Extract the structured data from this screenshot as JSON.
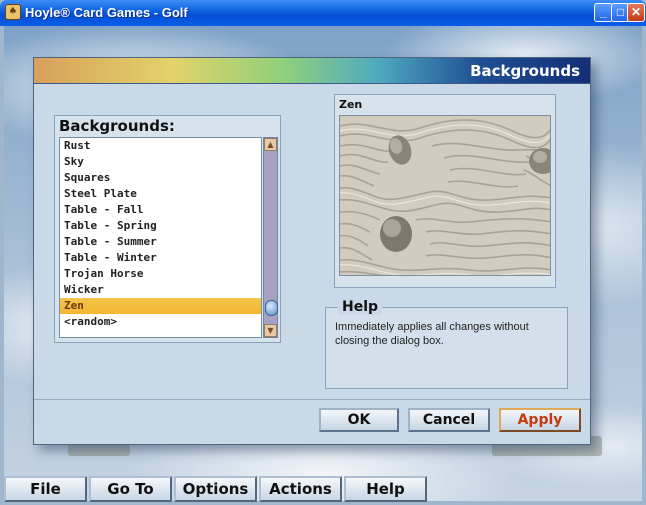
{
  "window": {
    "title": "Hoyle® Card Games - Golf",
    "icon": "app-icon",
    "buttons": {
      "minimize": "_",
      "maximize": "□",
      "close": "✕"
    }
  },
  "dialog": {
    "title": "Backgrounds",
    "list": {
      "label": "Backgrounds:",
      "items": [
        "Rust",
        "Sky",
        "Squares",
        "Steel Plate",
        "Table - Fall",
        "Table - Spring",
        "Table - Summer",
        "Table - Winter",
        "Trojan Horse",
        "Wicker",
        "Zen",
        "<random>"
      ],
      "selected": "Zen"
    },
    "preview": {
      "label": "Zen"
    },
    "help": {
      "label": "Help",
      "text": "Immediately applies all changes without closing the dialog box."
    },
    "buttons": {
      "ok": "OK",
      "cancel": "Cancel",
      "apply": "Apply"
    }
  },
  "menubar": {
    "file": "File",
    "goto": "Go To",
    "options": "Options",
    "actions": "Actions",
    "help": "Help"
  },
  "colors": {
    "title_bar": "#0a5fe0",
    "dialog_bg": "#c9d9e7",
    "selection": "#f5b632",
    "apply_text": "#c53a10"
  }
}
